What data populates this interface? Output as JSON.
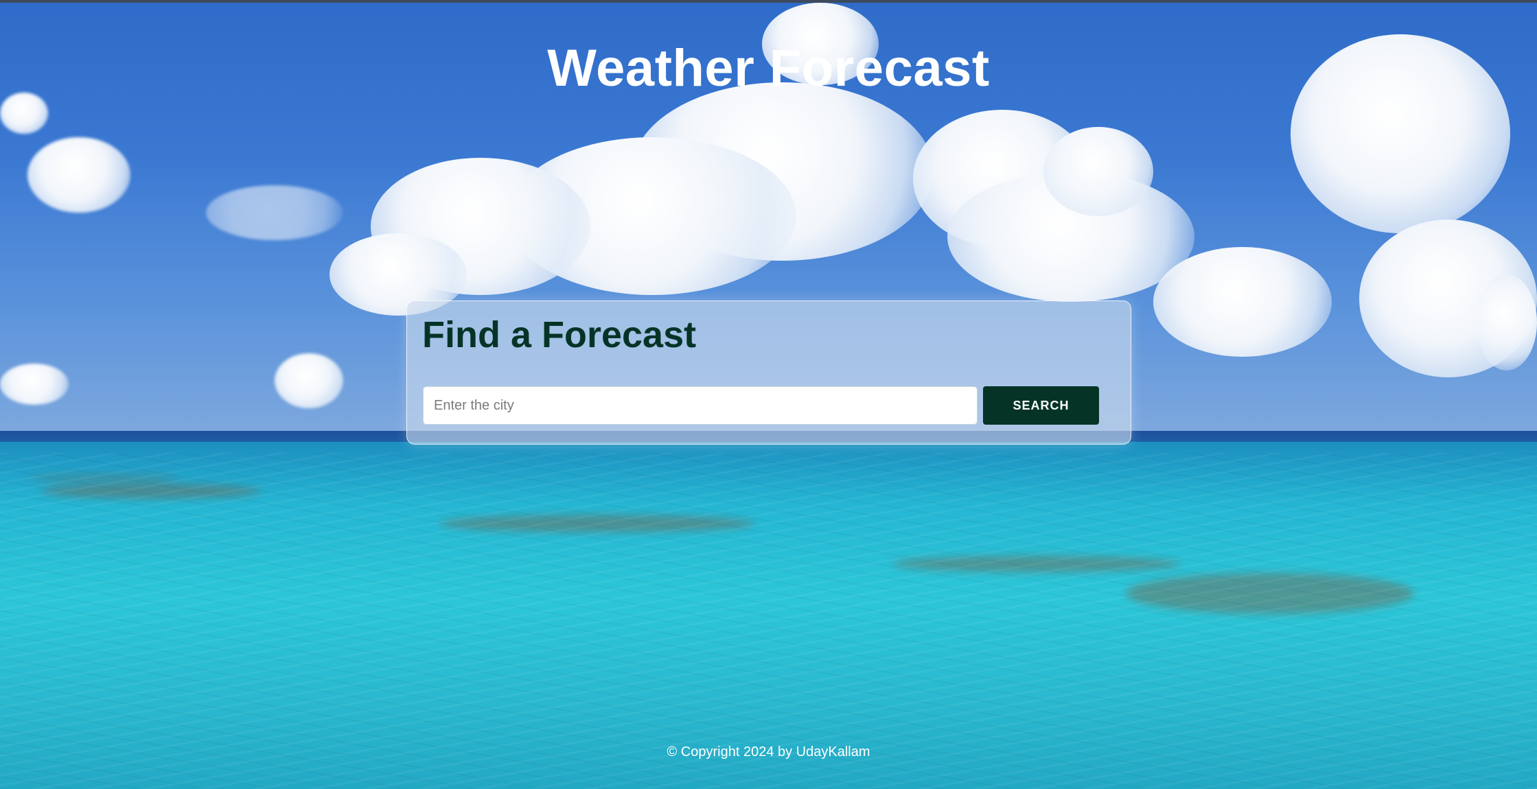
{
  "header": {
    "title": "Weather Forecast"
  },
  "search_card": {
    "title": "Find a Forecast",
    "input_placeholder": "Enter the city",
    "input_value": "",
    "button_label": "SEARCH"
  },
  "footer": {
    "text": "© Copyright 2024 by UdayKallam"
  },
  "colors": {
    "accent": "#053427",
    "title_text": "#ffffff",
    "card_background": "#cddcee"
  }
}
